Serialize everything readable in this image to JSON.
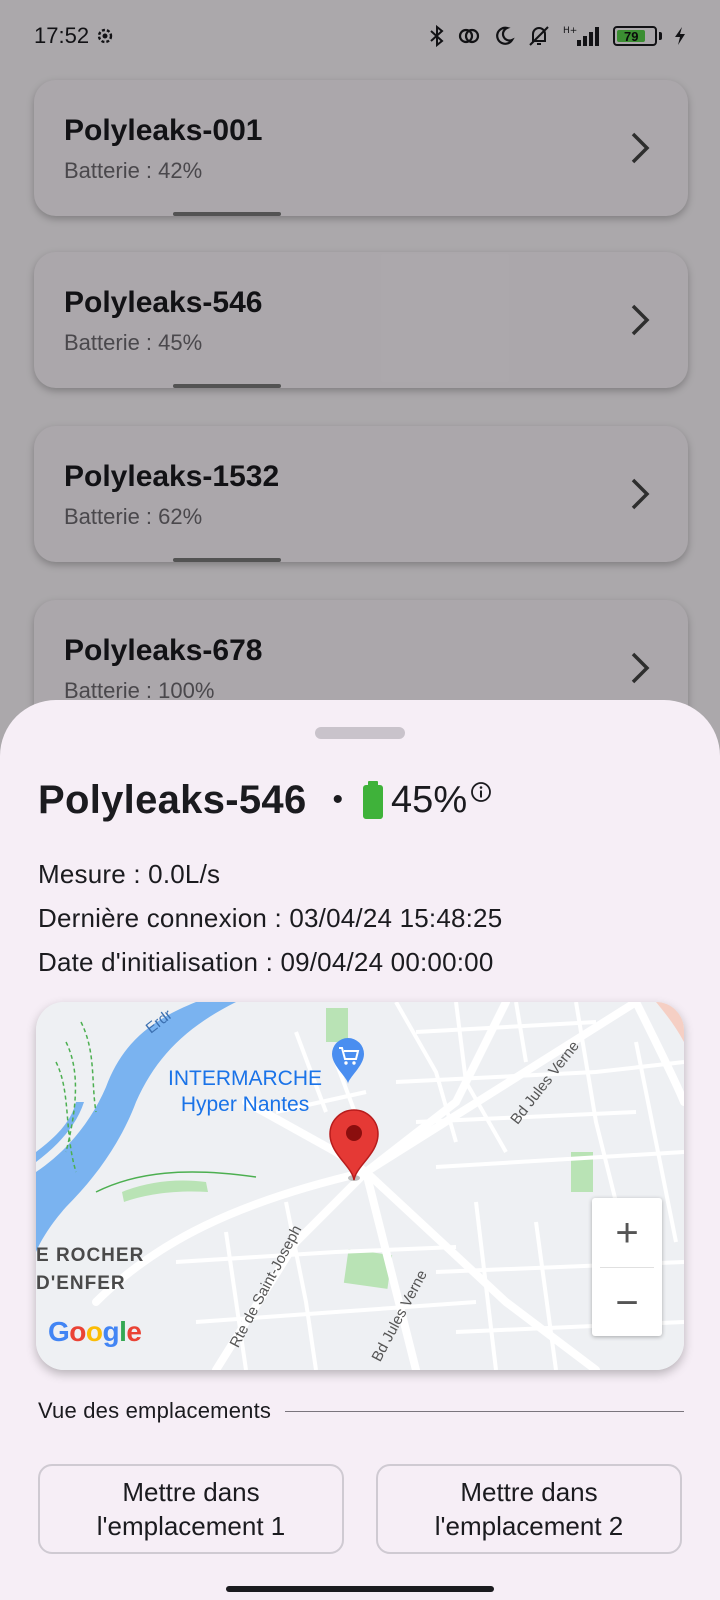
{
  "status_bar": {
    "time": "17:52",
    "battery_level": "79",
    "icons": [
      "settings-gear-icon",
      "bluetooth-icon",
      "hotspot-icon",
      "moon-icon",
      "mute-icon",
      "signal-icon",
      "battery-icon",
      "charging-icon"
    ],
    "network_type": "H+"
  },
  "devices": [
    {
      "name": "Polyleaks-001",
      "battery": "Batterie : 42%"
    },
    {
      "name": "Polyleaks-546",
      "battery": "Batterie : 45%"
    },
    {
      "name": "Polyleaks-1532",
      "battery": "Batterie : 62%"
    },
    {
      "name": "Polyleaks-678",
      "battery": "Batterie : 100%"
    }
  ],
  "sheet": {
    "title": "Polyleaks-546",
    "separator": "•",
    "battery_percent": "45%",
    "battery_fill_fraction": 0.45,
    "measure": "Mesure : 0.0L/s",
    "last_connection": "Dernière connexion : 03/04/24 15:48:25",
    "init_date": "Date d'initialisation : 09/04/24 00:00:00",
    "map": {
      "poi_line1": "INTERMARCHE",
      "poi_line2": "Hyper Nantes",
      "area_line1": "E ROCHER",
      "area_line2": "D'ENFER",
      "river_label": "Erdr",
      "roads": [
        "Bd Jules Verne",
        "Rte de Saint-Joseph",
        "Bd Jules Verne"
      ],
      "provider": "Google",
      "zoom_in": "+",
      "zoom_out": "−"
    },
    "section_label": "Vue des emplacements",
    "slot1_label": "Mettre dans l'emplacement 1",
    "slot2_label": "Mettre dans l'emplacement 2"
  },
  "colors": {
    "sheet_bg": "#f6eef6",
    "battery_green": "#3fb23a",
    "map_water": "#7ab3f0",
    "map_park": "#b9e3b5",
    "marker_red": "#e53935",
    "poi_blue": "#1a73e8"
  }
}
